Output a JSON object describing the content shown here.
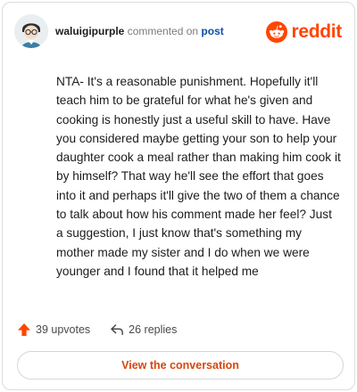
{
  "header": {
    "username": "waluigipurple",
    "action": "commented on",
    "post_link": "post",
    "logo_text": "reddit"
  },
  "comment": {
    "text": "NTA- It's a reasonable punishment. Hopefully it'll teach him to be grateful for what he's given and cooking is honestly just a useful skill to have. Have you considered maybe getting your son to help your daughter cook a meal rather than making him cook it by himself? That way he'll see the effort that goes into it and perhaps it'll give the two of them a chance to talk about how his comment made her feel? Just a suggestion, I just know that's something my mother made my sister and I do when we were younger and I found that it helped me"
  },
  "stats": {
    "upvotes": "39 upvotes",
    "replies": "26 replies"
  },
  "footer": {
    "view_button": "View the conversation"
  },
  "colors": {
    "brand": "#ff4500",
    "link": "#0b4fa8",
    "button_text": "#d9460c"
  },
  "icons": {
    "avatar": "user-avatar",
    "logo": "reddit-snoo-icon",
    "upvote": "upvote-arrow-icon",
    "reply": "reply-arrow-icon"
  }
}
